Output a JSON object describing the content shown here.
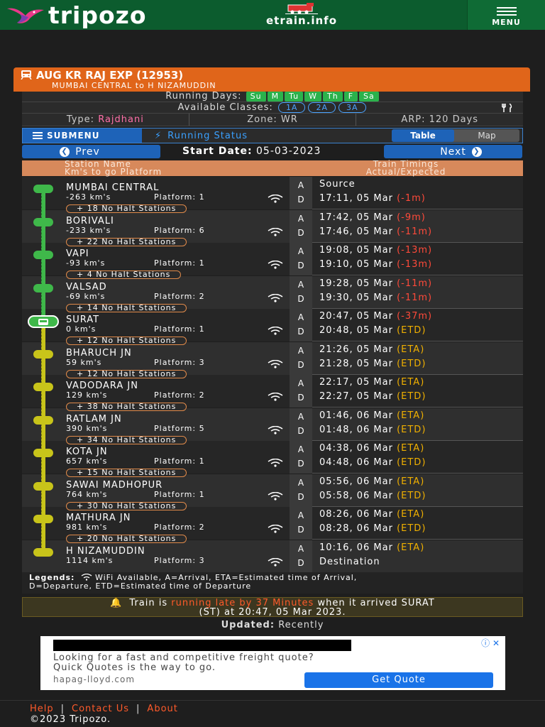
{
  "header": {
    "logo_text": "tripozo",
    "center_text": "etrain.info",
    "menu_label": "MENU"
  },
  "train": {
    "name": "AUG KR RAJ EXP (12953)",
    "route": "MUMBAI CENTRAL to H NIZAMUDDIN",
    "running_days_label": "Running Days:",
    "running_days": [
      "Su",
      "M",
      "Tu",
      "W",
      "Th",
      "F",
      "Sa"
    ],
    "classes_label": "Available Classes:",
    "classes": [
      "1A",
      "2A",
      "3A"
    ],
    "type_label": "Type:",
    "type_value": "Rajdhani",
    "zone": "Zone: WR",
    "arp": "ARP: 120 Days"
  },
  "toolbar": {
    "submenu": "SUBMENU",
    "running_status": "Running Status",
    "table": "Table",
    "map": "Map",
    "prev": "Prev",
    "next": "Next",
    "start_date_label": "Start Date:",
    "start_date_value": "05-03-2023"
  },
  "columns": {
    "station_name": "Station Name",
    "station_sub": "Km's to go   Platform",
    "timings": "Train Timings",
    "timings_sub": "Actual/Expected"
  },
  "stations": [
    {
      "name": "MUMBAI CENTRAL",
      "km": "-263 km's",
      "platform": "Platform: 1",
      "halt": "+ 18 No Halt Stations",
      "arr": "Source",
      "arr_delay": "",
      "dep": "17:11, 05 Mar",
      "dep_delay": "(-1m)"
    },
    {
      "name": "BORIVALI",
      "km": "-233 km's",
      "platform": "Platform: 6",
      "halt": "+ 22 No Halt Stations",
      "arr": "17:42, 05 Mar",
      "arr_delay": "(-9m)",
      "dep": "17:46, 05 Mar",
      "dep_delay": "(-11m)"
    },
    {
      "name": "VAPI",
      "km": "-93 km's",
      "platform": "Platform: 1",
      "halt": "+ 4 No Halt Stations",
      "arr": "19:08, 05 Mar",
      "arr_delay": "(-13m)",
      "dep": "19:10, 05 Mar",
      "dep_delay": "(-13m)"
    },
    {
      "name": "VALSAD",
      "km": "-69 km's",
      "platform": "Platform: 2",
      "halt": "+ 14 No Halt Stations",
      "arr": "19:28, 05 Mar",
      "arr_delay": "(-11m)",
      "dep": "19:30, 05 Mar",
      "dep_delay": "(-11m)"
    },
    {
      "name": "SURAT",
      "km": "0 km's",
      "platform": "Platform: 1",
      "halt": "+ 12 No Halt Stations",
      "arr": "20:47, 05 Mar",
      "arr_delay": "(-37m)",
      "dep": "20:48, 05 Mar",
      "dep_delay": "(ETD)"
    },
    {
      "name": "BHARUCH JN",
      "km": "59 km's",
      "platform": "Platform: 3",
      "halt": "+ 12 No Halt Stations",
      "arr": "21:26, 05 Mar",
      "arr_delay": "(ETA)",
      "dep": "21:28, 05 Mar",
      "dep_delay": "(ETD)"
    },
    {
      "name": "VADODARA JN",
      "km": "129 km's",
      "platform": "Platform: 2",
      "halt": "+ 38 No Halt Stations",
      "arr": "22:17, 05 Mar",
      "arr_delay": "(ETA)",
      "dep": "22:27, 05 Mar",
      "dep_delay": "(ETD)"
    },
    {
      "name": "RATLAM JN",
      "km": "390 km's",
      "platform": "Platform: 5",
      "halt": "+ 34 No Halt Stations",
      "arr": "01:46, 06 Mar",
      "arr_delay": "(ETA)",
      "dep": "01:48, 06 Mar",
      "dep_delay": "(ETD)"
    },
    {
      "name": "KOTA JN",
      "km": "657 km's",
      "platform": "Platform: 1",
      "halt": "+ 15 No Halt Stations",
      "arr": "04:38, 06 Mar",
      "arr_delay": "(ETA)",
      "dep": "04:48, 06 Mar",
      "dep_delay": "(ETD)"
    },
    {
      "name": "SAWAI MADHOPUR",
      "km": "764 km's",
      "platform": "Platform: 1",
      "halt": "+ 30 No Halt Stations",
      "arr": "05:56, 06 Mar",
      "arr_delay": "(ETA)",
      "dep": "05:58, 06 Mar",
      "dep_delay": "(ETD)"
    },
    {
      "name": "MATHURA JN",
      "km": "981 km's",
      "platform": "Platform: 2",
      "halt": "+ 20 No Halt Stations",
      "arr": "08:26, 06 Mar",
      "arr_delay": "(ETA)",
      "dep": "08:28, 06 Mar",
      "dep_delay": "(ETD)"
    },
    {
      "name": "H NIZAMUDDIN",
      "km": "1114 km's",
      "platform": "Platform: 3",
      "halt": "",
      "arr": "10:16, 06 Mar",
      "arr_delay": "(ETA)",
      "dep": "Destination",
      "dep_delay": ""
    }
  ],
  "legend": {
    "title": "Legends:",
    "line1": "WiFi Available, A=Arrival, ETA=Estimated time of Arrival,",
    "line2": "D=Departure, ETD=Estimated time of Departure"
  },
  "status": {
    "prefix": "Train is",
    "highlight": "running late by 37 Minutes",
    "suffix": "when it arrived SURAT",
    "line2": "(ST) at 20:47, 05 Mar 2023."
  },
  "updated": {
    "label": "Updated:",
    "value": "Recently"
  },
  "ad": {
    "line1": "Looking for a fast and competitive freight quote?",
    "line2": "Quick Quotes is the way to go.",
    "url": "hapag-lloyd.com",
    "button": "Get Quote"
  },
  "footer": {
    "help": "Help",
    "contact": "Contact Us",
    "about": "About",
    "copyright": "©2023 Tripozo."
  },
  "colors": {
    "header_green": "#0c5c2e",
    "title_orange": "#e0651a",
    "blue": "#1e63b8",
    "late_red": "#ff4a3a",
    "eta_amber": "#f0b000",
    "track_green": "#3fb84a",
    "track_yellow": "#c8c41a"
  }
}
